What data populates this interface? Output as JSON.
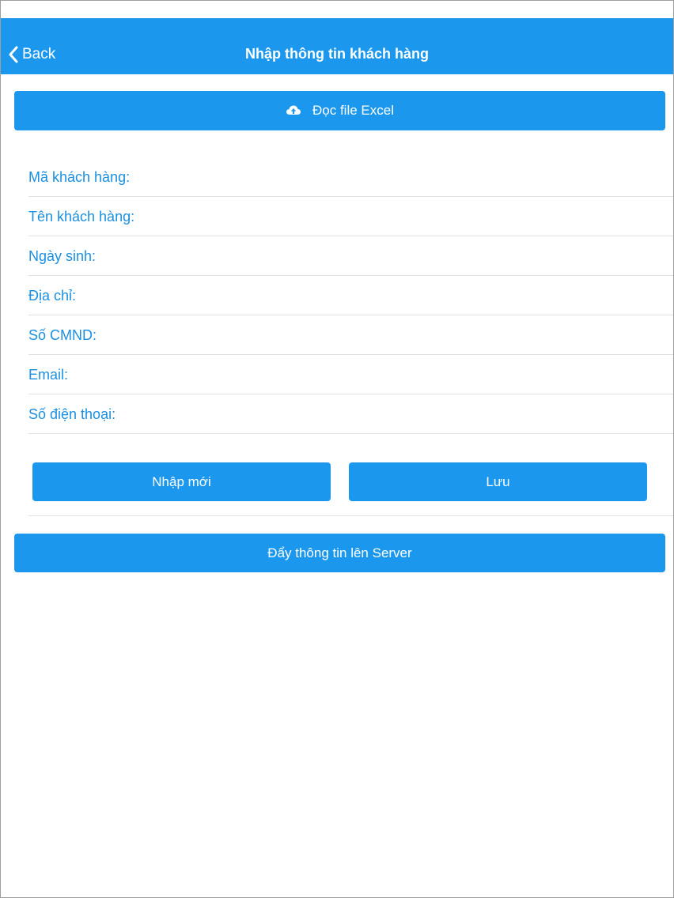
{
  "nav": {
    "back_label": "Back",
    "title": "Nhập thông tin khách hàng"
  },
  "actions": {
    "read_excel_label": "Đọc file Excel",
    "read_excel_icon": "cloud-upload-icon",
    "new_label": "Nhập mới",
    "save_label": "Lưu",
    "push_label": "Đẩy thông tin lên Server"
  },
  "form": {
    "fields": [
      {
        "label": "Mã khách hàng:",
        "value": ""
      },
      {
        "label": "Tên khách hàng:",
        "value": ""
      },
      {
        "label": "Ngày sinh:",
        "value": ""
      },
      {
        "label": "Địa chỉ:",
        "value": ""
      },
      {
        "label": "Số CMND:",
        "value": ""
      },
      {
        "label": "Email:",
        "value": ""
      },
      {
        "label": "Số điện thoại:",
        "value": ""
      }
    ]
  },
  "colors": {
    "accent": "#1b98ee",
    "label": "#1b8fe0",
    "separator": "#e2e2e2"
  }
}
